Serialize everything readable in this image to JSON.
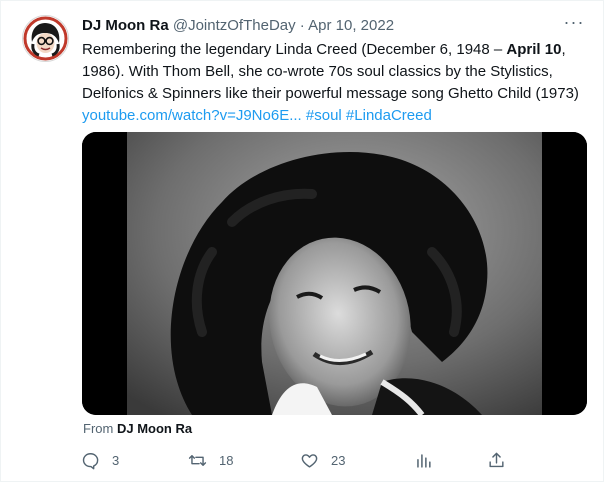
{
  "tweet": {
    "author_name": "DJ Moon Ra",
    "handle": "@JointzOfTheDay",
    "separator": "·",
    "date": "Apr 10, 2022",
    "text_part1": "Remembering the legendary Linda Creed (December 6, 1948 – ",
    "text_bold": "April 10",
    "text_part2": ", 1986). With Thom Bell, she co-wrote 70s soul classics by the Stylistics, Delfonics & Spinners like their powerful message song Ghetto Child (1973) ",
    "link": "youtube.com/watch?v=J9No6E...",
    "hashtag1": "#soul",
    "hashtag2": "#LindaCreed",
    "from_label": "From",
    "from_name": "DJ Moon Ra",
    "more_label": "···"
  },
  "actions": {
    "replies": "3",
    "retweets": "18",
    "likes": "23"
  },
  "icons": {
    "more": "more-horizontal-icon",
    "reply": "reply-icon",
    "retweet": "retweet-icon",
    "like": "heart-icon",
    "analytics": "analytics-icon",
    "share": "share-icon"
  },
  "colors": {
    "link": "#1d9bf0",
    "muted": "#536471",
    "text": "#0f1419"
  }
}
